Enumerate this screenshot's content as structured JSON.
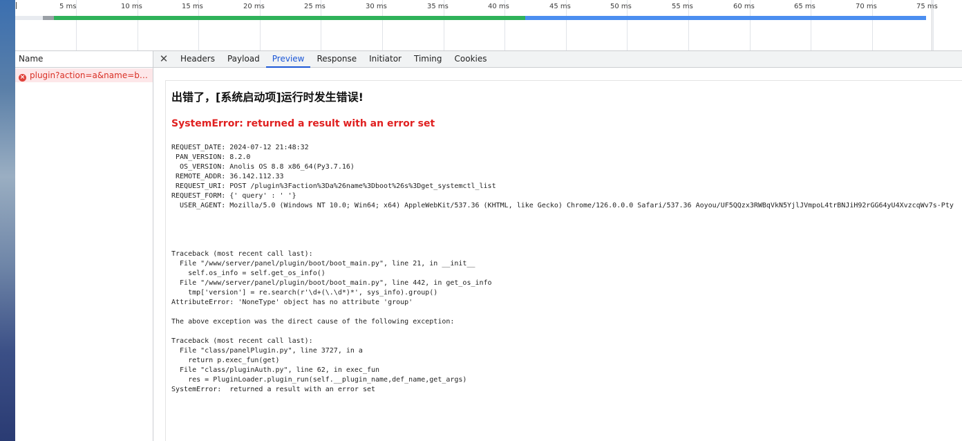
{
  "timeline": {
    "ticks": [
      "5 ms",
      "10 ms",
      "15 ms",
      "20 ms",
      "25 ms",
      "30 ms",
      "35 ms",
      "40 ms",
      "45 ms",
      "50 ms",
      "55 ms",
      "60 ms",
      "65 ms",
      "70 ms",
      "75 ms"
    ],
    "segments": {
      "queueing_color": "#9aa0a6",
      "waiting_color": "#2fb25a",
      "download_color": "#4b8ef0"
    }
  },
  "request_list": {
    "header": "Name",
    "rows": [
      {
        "name": "plugin?action=a&name=boot&...",
        "status": "error",
        "status_icon": "error-circle-icon"
      }
    ]
  },
  "detail": {
    "close_icon": "close-icon",
    "tabs": [
      {
        "label": "Headers"
      },
      {
        "label": "Payload"
      },
      {
        "label": "Preview",
        "active": true
      },
      {
        "label": "Response"
      },
      {
        "label": "Initiator"
      },
      {
        "label": "Timing"
      },
      {
        "label": "Cookies"
      }
    ],
    "preview": {
      "title": "出错了，[系统启动项]运行时发生错误!",
      "error_summary": "SystemError: returned a result with an error set",
      "request_info": [
        "REQUEST_DATE: 2024-07-12 21:48:32",
        " PAN_VERSION: 8.2.0",
        "  OS_VERSION: Anolis OS 8.8 x86_64(Py3.7.16)",
        " REMOTE_ADDR: 36.142.112.33",
        " REQUEST_URI: POST /plugin%3Faction%3Da%26name%3Dboot%26s%3Dget_systemctl_list",
        "REQUEST_FORM: {' query' : ' '}",
        "  USER_AGENT: Mozilla/5.0 (Windows NT 10.0; Win64; x64) AppleWebKit/537.36 (KHTML, like Gecko) Chrome/126.0.0.0 Safari/537.36 Aoyou/UF5QQzx3RWBqVkN5YjlJVmpoL4trBNJiH92rGG64yU4XvzcqWv7s-Pty"
      ],
      "traceback": [
        "Traceback (most recent call last):",
        "  File \"/www/server/panel/plugin/boot/boot_main.py\", line 21, in __init__",
        "    self.os_info = self.get_os_info()",
        "  File \"/www/server/panel/plugin/boot/boot_main.py\", line 442, in get_os_info",
        "    tmp['version'] = re.search(r'\\d+(\\.\\d*)*', sys_info).group()",
        "AttributeError: 'NoneType' object has no attribute 'group'",
        "",
        "The above exception was the direct cause of the following exception:",
        "",
        "Traceback (most recent call last):",
        "  File \"class/panelPlugin.py\", line 3727, in a",
        "    return p.exec_fun(get)",
        "  File \"class/pluginAuth.py\", line 62, in exec_fun",
        "    res = PluginLoader.plugin_run(self.__plugin_name,def_name,get_args)",
        "SystemError:  returned a result with an error set"
      ]
    }
  }
}
